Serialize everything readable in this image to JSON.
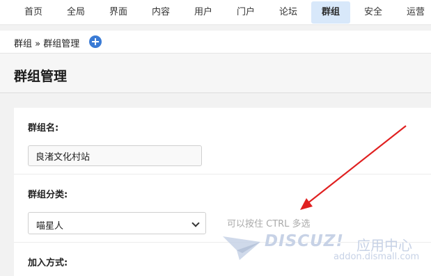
{
  "nav": {
    "items": [
      {
        "label": "首页"
      },
      {
        "label": "全局"
      },
      {
        "label": "界面"
      },
      {
        "label": "内容"
      },
      {
        "label": "用户"
      },
      {
        "label": "门户"
      },
      {
        "label": "论坛"
      },
      {
        "label": "群组"
      },
      {
        "label": "安全"
      },
      {
        "label": "运营"
      }
    ],
    "active": "群组"
  },
  "breadcrumb": "群组 » 群组管理",
  "page_title": "群组管理",
  "form": {
    "group_name_label": "群组名:",
    "group_name_value": "良渚文化村站",
    "category_label": "群组分类:",
    "category_value": "喵星人",
    "category_hint": "可以按住 CTRL 多选",
    "join_label": "加入方式:"
  },
  "watermark": {
    "brand": "DISCUZ!",
    "sub": "应用中心",
    "url": "addon.dismall.com"
  },
  "colors": {
    "accent": "#3a7bd5",
    "active_tab": "#d8e8fa",
    "annotation_arrow": "#e02020"
  }
}
